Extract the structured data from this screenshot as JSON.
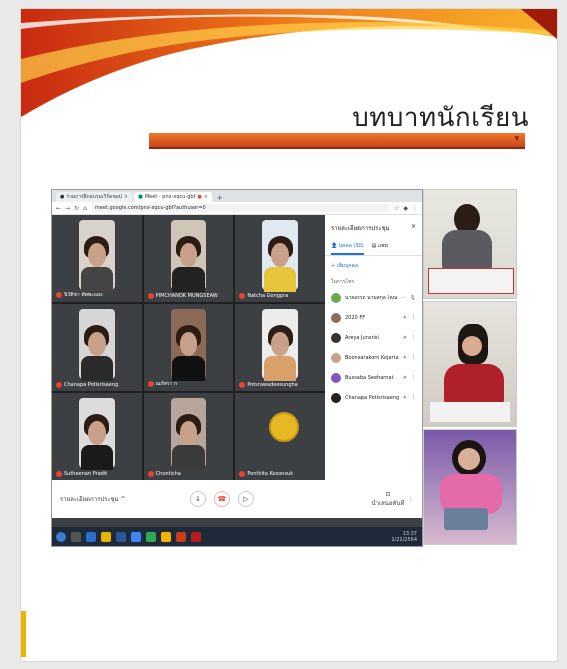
{
  "slide": {
    "title": "บทบาทนักเรียน",
    "colors": {
      "accent_orange": "#f07a2a",
      "accent_red": "#c8441a",
      "side_tab": "#e8b400"
    }
  },
  "browser": {
    "tabs": [
      {
        "label": "ร่วมการฝึกอบรมเวิร์คชอป"
      },
      {
        "label": "Meet - pnx-xqcu-gbf"
      }
    ],
    "url": "meet.google.com/pnx-xqcu-gbf?authuser=0"
  },
  "meet": {
    "participants_grid": [
      {
        "name": "นิวัติชา ทัพพะแสง"
      },
      {
        "name": "PIMCHANOK MUNGSEAW"
      },
      {
        "name": "Natcha Gongpra"
      },
      {
        "name": "Chanapa Potisrisaeng"
      },
      {
        "name": "ณภัทรา ก"
      },
      {
        "name": "Potsrawadeesungha"
      },
      {
        "name": "Sutheenan Pradit"
      },
      {
        "name": "Chonticha"
      },
      {
        "name": "Ponthita Kosonsuk"
      }
    ],
    "panel": {
      "title": "รายละเอียดการประชุม",
      "tab_people": "บุคคล (30)",
      "tab_chat": "แชท",
      "add_people": "เพิ่มบุคคล",
      "section": "ในการโทร",
      "people": [
        {
          "name": "นายอรรถ นามสกุล (คุณ)"
        },
        {
          "name": "2020 FF"
        },
        {
          "name": "Areya Junsrisi"
        },
        {
          "name": "Boonsarakorn Kojarta"
        },
        {
          "name": "Bussaba Seeharnat"
        },
        {
          "name": "Chanapa Potisrisaeng"
        }
      ]
    },
    "bottom": {
      "meeting_details": "รายละเอียดการประชุม",
      "present_label": "นำเสนอทันที"
    },
    "tray_time": "13:37",
    "tray_date": "1/21/2564"
  }
}
